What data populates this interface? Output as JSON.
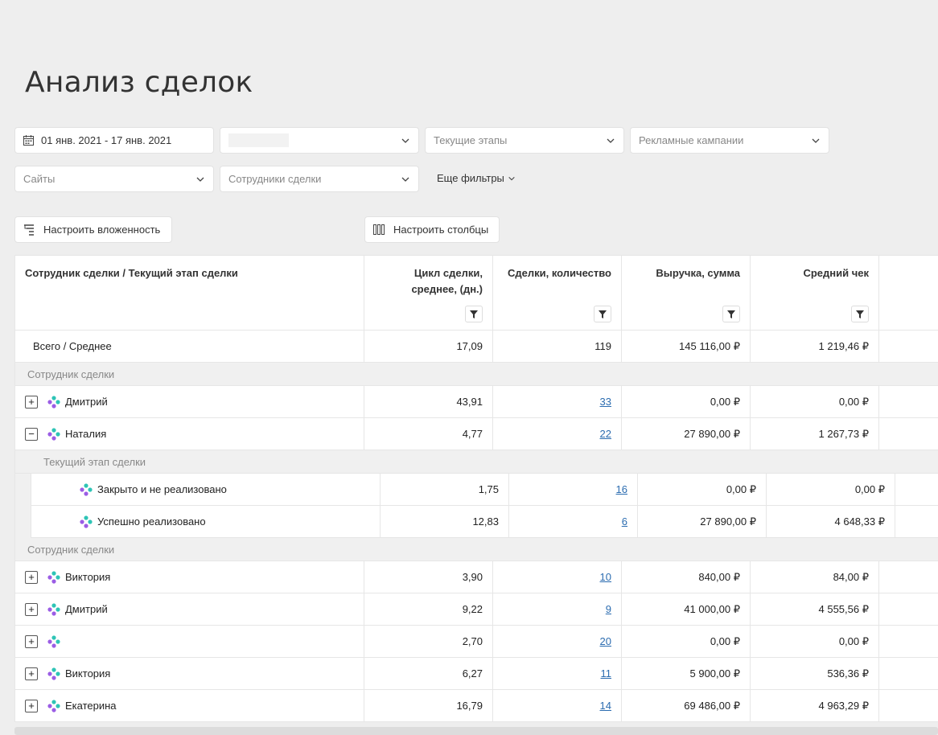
{
  "page": {
    "title": "Анализ сделок"
  },
  "filters": {
    "date_range": "01 янв. 2021 - 17 янв. 2021",
    "stages_placeholder": "Текущие этапы",
    "campaigns_placeholder": "Рекламные кампании",
    "sites_placeholder": "Сайты",
    "employees_placeholder": "Сотрудники сделки",
    "more_filters": "Еще фильтры"
  },
  "toolbar": {
    "nesting_label": "Настроить вложенность",
    "columns_label": "Настроить столбцы"
  },
  "table": {
    "columns": [
      "Сотрудник сделки / Текущий этап сделки",
      "Цикл сделки, среднее, (дн.)",
      "Сделки, количество",
      "Выручка, сумма",
      "Средний чек"
    ],
    "total": {
      "name": "Всего / Среднее",
      "cycle": "17,09",
      "count": "119",
      "revenue": "145 116,00 ₽",
      "avg": "1 219,46 ₽"
    },
    "section_employee": "Сотрудник сделки",
    "section_stage": "Текущий этап сделки",
    "group1": [
      {
        "toggle": "+",
        "name": "Дмитрий",
        "cycle": "43,91",
        "count": "33",
        "revenue": "0,00 ₽",
        "avg": "0,00 ₽"
      },
      {
        "toggle": "−",
        "name": "Наталия",
        "cycle": "4,77",
        "count": "22",
        "revenue": "27 890,00 ₽",
        "avg": "1 267,73 ₽"
      }
    ],
    "stages": [
      {
        "name": "Закрыто и не реализовано",
        "cycle": "1,75",
        "count": "16",
        "revenue": "0,00 ₽",
        "avg": "0,00 ₽"
      },
      {
        "name": "Успешно реализовано",
        "cycle": "12,83",
        "count": "6",
        "revenue": "27 890,00 ₽",
        "avg": "4 648,33 ₽"
      }
    ],
    "group2": [
      {
        "toggle": "+",
        "name": "Виктория",
        "cycle": "3,90",
        "count": "10",
        "revenue": "840,00 ₽",
        "avg": "84,00 ₽"
      },
      {
        "toggle": "+",
        "name": "Дмитрий",
        "cycle": "9,22",
        "count": "9",
        "revenue": "41 000,00 ₽",
        "avg": "4 555,56 ₽"
      },
      {
        "toggle": "+",
        "name": "",
        "cycle": "2,70",
        "count": "20",
        "revenue": "0,00 ₽",
        "avg": "0,00 ₽"
      },
      {
        "toggle": "+",
        "name": "Виктория",
        "cycle": "6,27",
        "count": "11",
        "revenue": "5 900,00 ₽",
        "avg": "536,36 ₽"
      },
      {
        "toggle": "+",
        "name": "Екатерина",
        "cycle": "16,79",
        "count": "14",
        "revenue": "69 486,00 ₽",
        "avg": "4 963,29 ₽"
      }
    ]
  },
  "colors": {
    "link": "#2b6cb0",
    "background": "#eeeeee",
    "dots_purple": "#9b5de5",
    "dots_teal": "#2ec4b6"
  }
}
